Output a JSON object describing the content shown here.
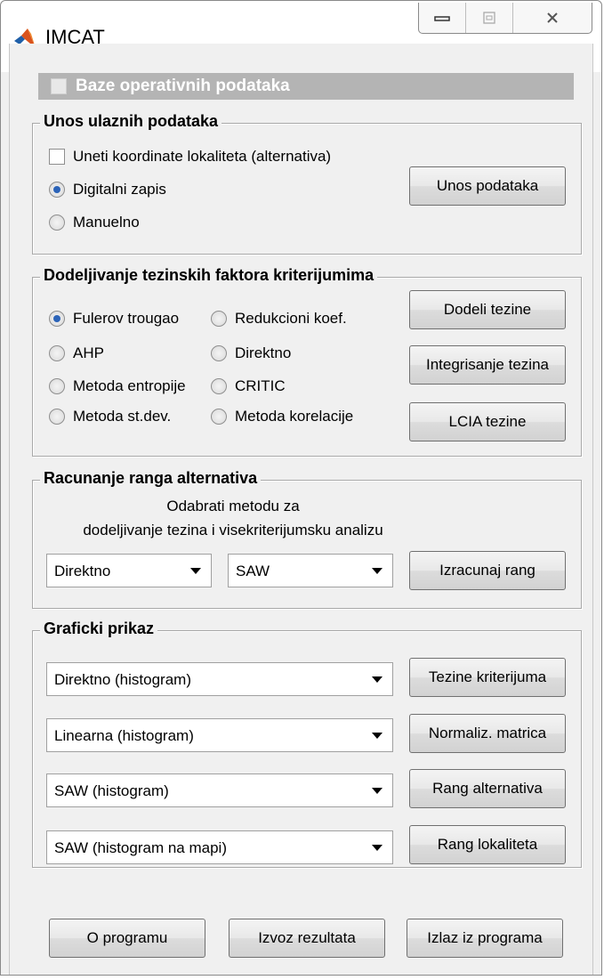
{
  "window": {
    "title": "IMCAT",
    "controls": [
      "minimize-icon",
      "maximize-icon",
      "close-icon"
    ]
  },
  "baze": {
    "label": "Baze operativnih podataka",
    "checked": false
  },
  "unos": {
    "title": "Unos ulaznih podataka",
    "checkbox_label": "Uneti koordinate lokaliteta (alternativa)",
    "radio_digital": "Digitalni zapis",
    "radio_manual": "Manuelno",
    "selected": "Digitalni zapis",
    "button": "Unos podataka"
  },
  "tezine": {
    "title": "Dodeljivanje tezinskih faktora kriterijumima",
    "options": [
      "Fulerov trougao",
      "Redukcioni koef.",
      "AHP",
      "Direktno",
      "Metoda entropije",
      "CRITIC",
      "Metoda st.dev.",
      "Metoda korelacije"
    ],
    "selected": "Fulerov trougao",
    "buttons": [
      "Dodeli tezine",
      "Integrisanje tezina",
      "LCIA tezine"
    ]
  },
  "rang": {
    "title": "Racunanje ranga alternativa",
    "instruction_line1": "Odabrati metodu za",
    "instruction_line2": "dodeljivanje tezina i visekriterijumsku analizu",
    "select_weights": "Direktno",
    "select_method": "SAW",
    "button": "Izracunaj rang"
  },
  "grafik": {
    "title": "Graficki prikaz",
    "rows": [
      {
        "select": "Direktno (histogram)",
        "button": "Tezine kriterijuma"
      },
      {
        "select": "Linearna (histogram)",
        "button": "Normaliz. matrica"
      },
      {
        "select": "SAW (histogram)",
        "button": "Rang alternativa"
      },
      {
        "select": "SAW (histogram na mapi)",
        "button": "Rang lokaliteta"
      }
    ]
  },
  "footer": {
    "buttons": [
      "O programu",
      "Izvoz rezultata",
      "Izlaz iz programa"
    ]
  },
  "colors": {
    "radio_selected": "#2b63b8",
    "baze_bar": "#b4b4b4",
    "background": "#f0f0f0"
  }
}
